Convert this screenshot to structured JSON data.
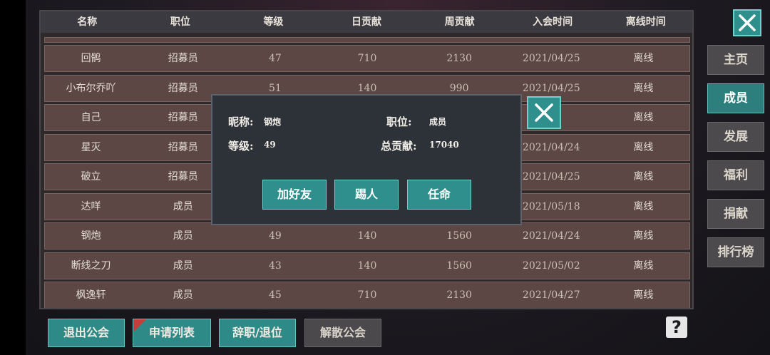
{
  "table": {
    "headers": [
      "名称",
      "职位",
      "等级",
      "日贡献",
      "周贡献",
      "入会时间",
      "离线时间"
    ],
    "rows": [
      [
        "回鹘",
        "招募员",
        "47",
        "710",
        "2130",
        "2021/04/25",
        "离线"
      ],
      [
        "小布尔乔吖",
        "招募员",
        "51",
        "140",
        "990",
        "2021/04/25",
        "离线"
      ],
      [
        "自己",
        "招募员",
        "",
        "",
        "",
        "/01",
        "离线"
      ],
      [
        "星灭",
        "招募员",
        "",
        "",
        "",
        "2021/04/24",
        "离线"
      ],
      [
        "破立",
        "招募员",
        "",
        "",
        "",
        "2021/04/25",
        "离线"
      ],
      [
        "达咩",
        "成员",
        "",
        "",
        "",
        "2021/05/18",
        "离线"
      ],
      [
        "钢炮",
        "成员",
        "49",
        "140",
        "1560",
        "2021/04/24",
        "离线"
      ],
      [
        "断线之刀",
        "成员",
        "43",
        "140",
        "1560",
        "2021/05/02",
        "离线"
      ],
      [
        "枫逸轩",
        "成员",
        "45",
        "710",
        "2130",
        "2021/04/27",
        "离线"
      ]
    ]
  },
  "nav": {
    "items": [
      "主页",
      "成员",
      "发展",
      "福利",
      "捐献",
      "排行榜"
    ],
    "active": "成员"
  },
  "bottom_buttons": {
    "quit": "退出公会",
    "apply_list": "申请列表",
    "resign": "辞职/退位",
    "dissolve": "解散公会"
  },
  "popup": {
    "nickname_label": "昵称:",
    "nickname_value": "钢炮",
    "position_label": "职位:",
    "position_value": "成员",
    "level_label": "等级:",
    "level_value": "49",
    "contrib_label": "总贡献:",
    "contrib_value": "17040",
    "add_friend": "加好友",
    "kick": "踢人",
    "appoint": "任命"
  },
  "help_icon_glyph": "?",
  "colors": {
    "teal": "#2f8f8c",
    "row_bg": "#5c4745",
    "popup_bg": "#2d3138"
  }
}
